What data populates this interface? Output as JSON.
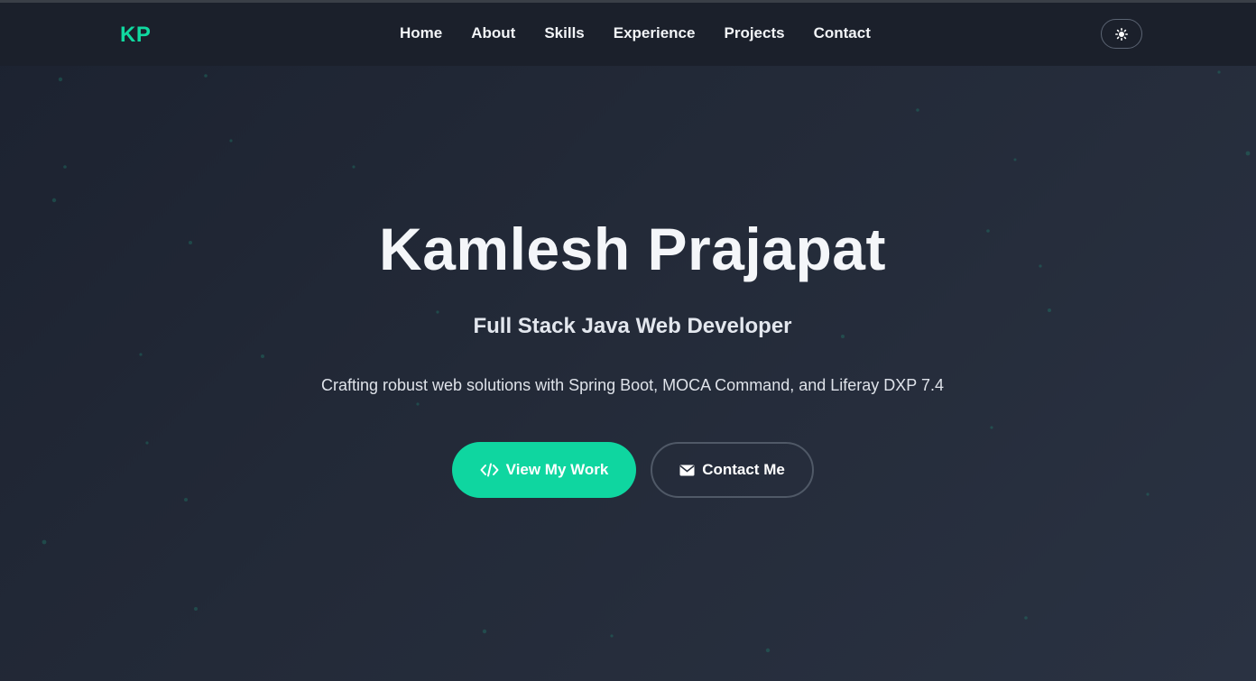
{
  "nav": {
    "logo": "KP",
    "links": [
      "Home",
      "About",
      "Skills",
      "Experience",
      "Projects",
      "Contact"
    ],
    "theme_toggle_icon": "sun-icon"
  },
  "hero": {
    "name": "Kamlesh Prajapat",
    "title": "Full Stack Java Web Developer",
    "tagline": "Crafting robust web solutions with Spring Boot, MOCA Command, and Liferay DXP 7.4",
    "primary_button": {
      "label": "View My Work",
      "icon": "code-icon"
    },
    "secondary_button": {
      "label": "Contact Me",
      "icon": "envelope-icon"
    }
  },
  "colors": {
    "accent": "#10d9a0",
    "background": "#232a38",
    "navbar": "#1b202b"
  }
}
